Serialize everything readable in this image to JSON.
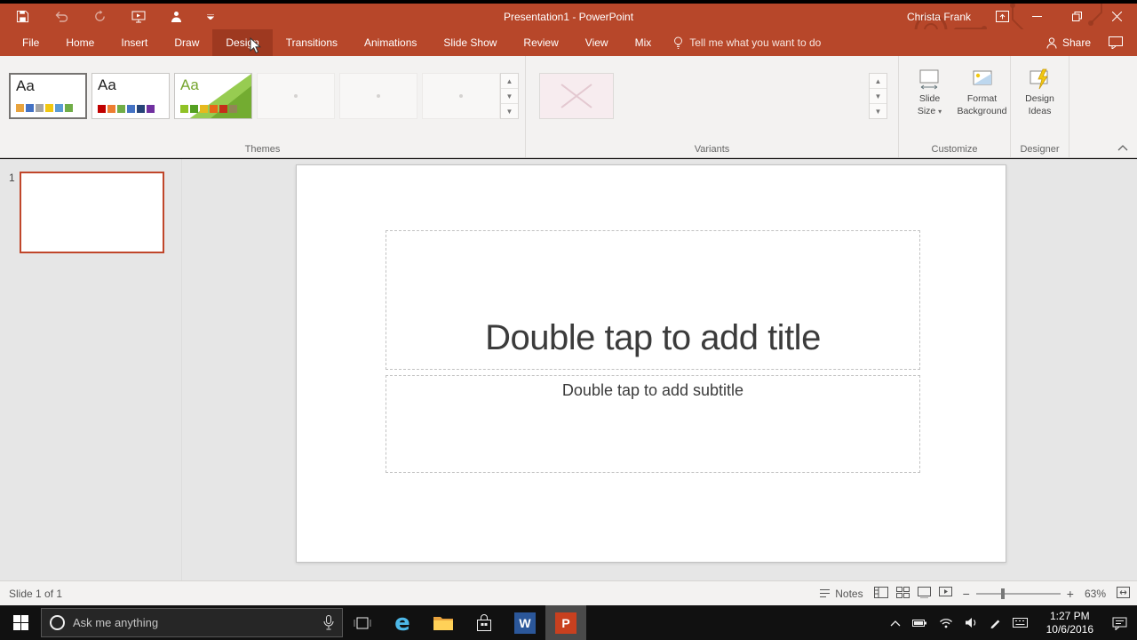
{
  "colors": {
    "app_red": "#B7472A",
    "tab_active": "#9E3920",
    "ribbon_bg": "#F3F2F1",
    "workspace_bg": "#E6E6E6",
    "selected_slide_border": "#C0462A",
    "taskbar_bg": "#111111",
    "powerpoint_icon": "#C8401F",
    "word_icon": "#2B579A",
    "edge_blue": "#4DB8E8"
  },
  "title_bar": {
    "title": "Presentation1 - PowerPoint",
    "user_name": "Christa Frank"
  },
  "ribbon": {
    "tabs": [
      {
        "label": "File",
        "active": false
      },
      {
        "label": "Home",
        "active": false
      },
      {
        "label": "Insert",
        "active": false
      },
      {
        "label": "Draw",
        "active": false
      },
      {
        "label": "Design",
        "active": true
      },
      {
        "label": "Transitions",
        "active": false
      },
      {
        "label": "Animations",
        "active": false
      },
      {
        "label": "Slide Show",
        "active": false
      },
      {
        "label": "Review",
        "active": false
      },
      {
        "label": "View",
        "active": false
      },
      {
        "label": "Mix",
        "active": false
      }
    ],
    "tell_me": "Tell me what you want to do",
    "share_label": "Share",
    "themes": {
      "group_label": "Themes",
      "thumbnails": [
        {
          "text": "Aa",
          "text_color": "#222222",
          "selected": true,
          "faded": false,
          "colors": [
            "#E8A33D",
            "#4472C4",
            "#A5A5A5",
            "#F2C811",
            "#5B9BD5",
            "#70AD47"
          ]
        },
        {
          "text": "Aa",
          "text_color": "#222222",
          "selected": false,
          "faded": false,
          "colors": [
            "#C00000",
            "#ED7D31",
            "#70AD47",
            "#4472C4",
            "#264478",
            "#7030A0"
          ]
        },
        {
          "text": "Aa",
          "text_color": "#76A52E",
          "selected": false,
          "faded": false,
          "decoration": "facet",
          "colors": [
            "#90C226",
            "#54A021",
            "#E6B91E",
            "#E76618",
            "#C42F1A",
            "#918655"
          ]
        },
        {
          "faded": true
        },
        {
          "faded": true
        },
        {
          "faded": true
        }
      ]
    },
    "variants": {
      "group_label": "Variants"
    },
    "customize": {
      "group_label": "Customize",
      "slide_size": {
        "line1": "Slide",
        "line2": "Size"
      },
      "format_background": {
        "line1": "Format",
        "line2": "Background"
      }
    },
    "designer": {
      "group_label": "Designer",
      "design_ideas": {
        "line1": "Design",
        "line2": "Ideas"
      }
    }
  },
  "slides_panel": {
    "slide_number": "1"
  },
  "slide_canvas": {
    "title_placeholder": "Double tap to add title",
    "subtitle_placeholder": "Double tap to add subtitle"
  },
  "status_bar": {
    "slide_indicator": "Slide 1 of 1",
    "notes_label": "Notes",
    "zoom_level": "63%"
  },
  "taskbar": {
    "search_placeholder": "Ask me anything",
    "clock": {
      "time": "1:27 PM",
      "date": "10/6/2016"
    }
  }
}
